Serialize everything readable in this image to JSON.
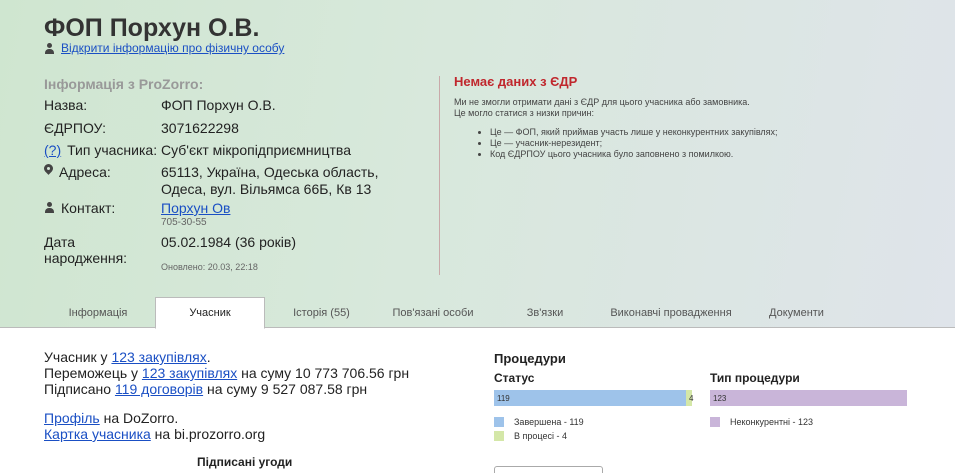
{
  "header": {
    "title": "ФОП Порхун О.В.",
    "open_info_link": "Відкрити інформацію про фізичну особу"
  },
  "prozorro_info": {
    "heading": "Інформація з ProZorro:",
    "name_label": "Назва:",
    "name_value": "ФОП Порхун О.В.",
    "edrpou_label": "ЄДРПОУ:",
    "edrpou_value": "3071622298",
    "type_help": "(?)",
    "type_label": "Тип учасника:",
    "type_value": "Суб'єкт мікропідприємництва",
    "address_label": "Адреса:",
    "address_value": "65113, Україна, Одеська область, Одеса, вул. Вільямса 66Б, Кв 13",
    "contact_label": "Контакт:",
    "contact_name": "Порхун Ов",
    "contact_phone": "705-30-55",
    "birth_label": "Дата народження:",
    "birth_value": "05.02.1984 (36 років)",
    "updated": "Оновлено: 20.03, 22:18"
  },
  "edr": {
    "title": "Немає даних з ЄДР",
    "line1": "Ми не змогли отримати дані з ЄДР для цього учасника або замовника.",
    "line2": "Це могло статися з низки причин:",
    "reasons": [
      "Це — ФОП, який приймав участь лише у неконкурентних закупівлях;",
      "Це — учасник-нерезидент;",
      "Код ЄДРПОУ цього учасника було заповнено з помилкою."
    ]
  },
  "tabs": [
    {
      "label": "Інформація"
    },
    {
      "label": "Учасник"
    },
    {
      "label": "Історія (55)"
    },
    {
      "label": "Пов'язані особи"
    },
    {
      "label": "Зв'язки"
    },
    {
      "label": "Виконавчі провадження"
    },
    {
      "label": "Документи"
    }
  ],
  "active_tab": "Учасник",
  "participant": {
    "t1": "Учасник у ",
    "t1_link": "123 закупівлях",
    "t1_end": ".",
    "t2": "Переможець у ",
    "t2_link": "123 закупівлях",
    "t2_end": " на суму 10 773 706.56 грн",
    "t3": "Підписано ",
    "t3_link": "119 договорів",
    "t3_end": " на суму 9 527 087.58 грн",
    "profile_link": "Профіль",
    "profile_end": " на DoZorro.",
    "card_link": "Картка учасника",
    "card_end": " на bi.prozorro.org",
    "signed_heading": "Підписані угоди"
  },
  "procedures": {
    "title": "Процедури",
    "status_title": "Статус",
    "type_title": "Тип процедури",
    "status_bars": [
      {
        "label": "119",
        "value": 119,
        "color": "#9ec3ea"
      },
      {
        "label": "4",
        "value": 4,
        "color": "#d4e7a8"
      }
    ],
    "status_legend": [
      {
        "text": "Завершена - 119",
        "color": "#9ec3ea"
      },
      {
        "text": "В процесі - 4",
        "color": "#d4e7a8"
      }
    ],
    "type_bars": [
      {
        "label": "123",
        "value": 123,
        "color": "#c9b5d9"
      }
    ],
    "type_legend": [
      {
        "text": "Неконкурентні - 123",
        "color": "#c9b5d9"
      }
    ]
  }
}
